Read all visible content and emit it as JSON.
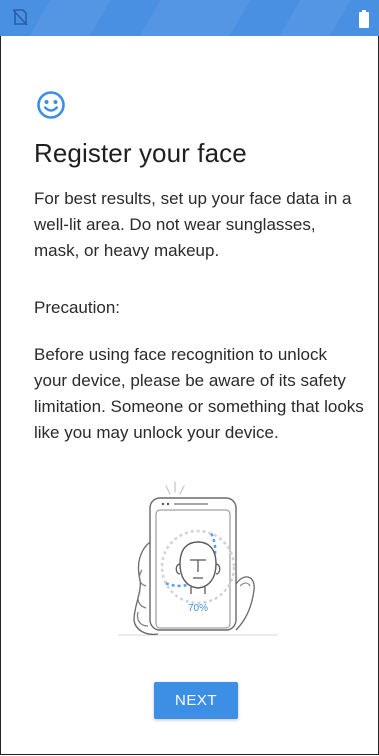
{
  "colors": {
    "status_bar": "#4a90e2",
    "accent": "#3d8fe6",
    "scan_progress": "#5a9ee8"
  },
  "status_bar": {
    "icons": [
      "no-sim-icon",
      "battery-icon"
    ]
  },
  "content": {
    "icon": "smiley-face-icon",
    "title": "Register your face",
    "intro": "For best results, set up your face data in a well-lit area. Do not wear sunglasses, mask, or heavy makeup.",
    "precaution_heading": "Precaution:",
    "precaution_text": "Before using face recognition to unlock your device, please be aware of its safety limitation. Someone or something that looks like you may unlock your device."
  },
  "illustration": {
    "icon": "face-scan-phone-illustration",
    "progress_label": "70%",
    "progress_fraction": 0.7
  },
  "actions": {
    "next_label": "NEXT"
  }
}
